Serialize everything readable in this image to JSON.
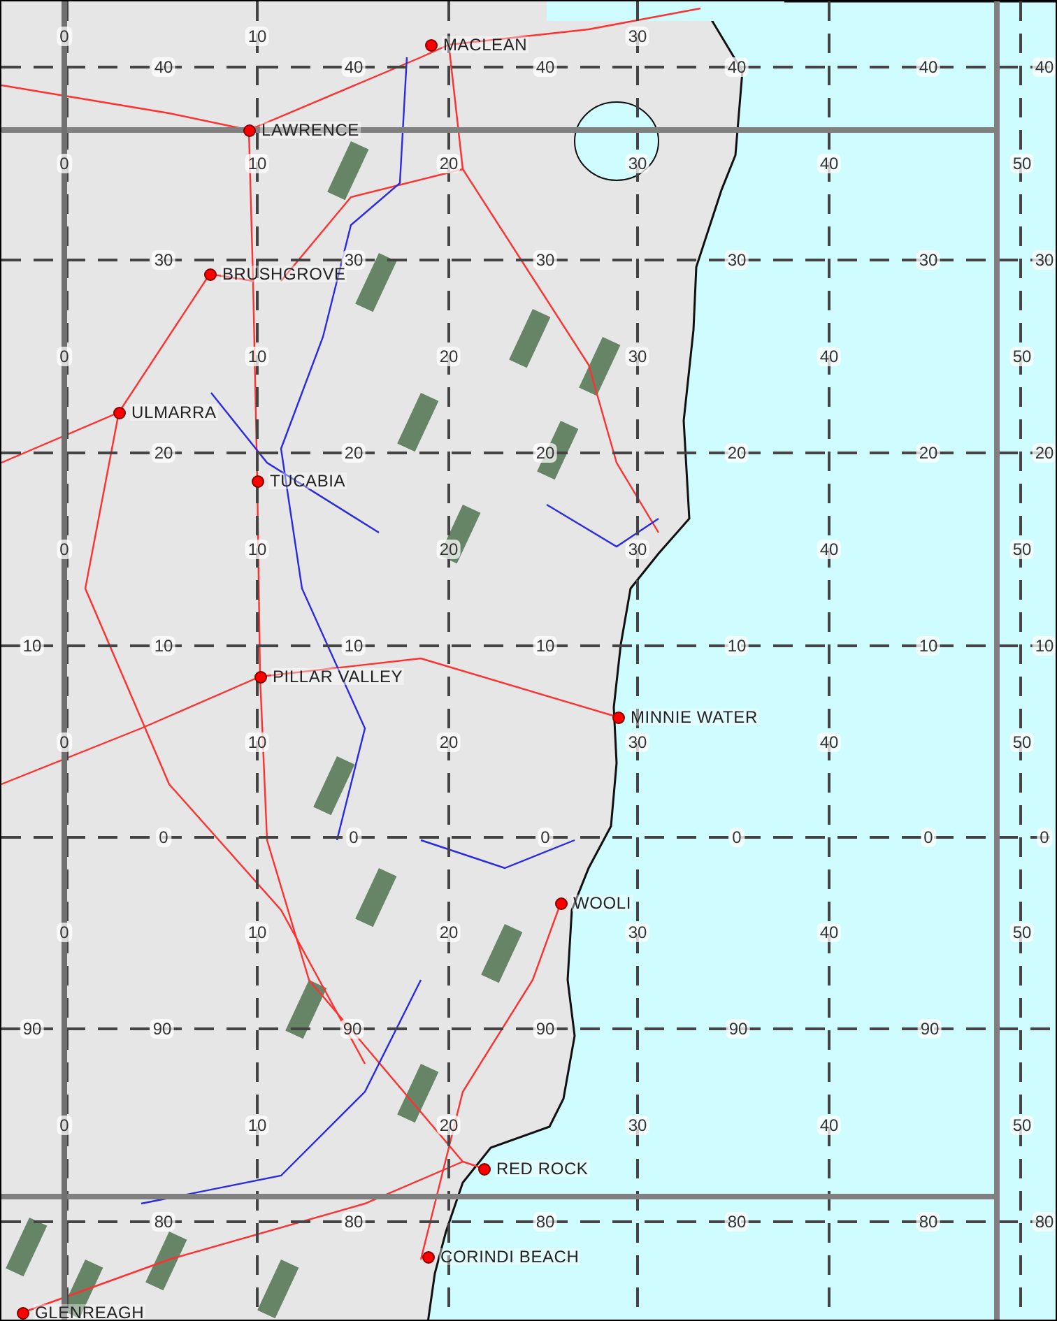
{
  "map": {
    "towns": [
      {
        "name": "MACLEAN"
      },
      {
        "name": "LAWRENCE"
      },
      {
        "name": "BRUSHGROVE"
      },
      {
        "name": "ULMARRA"
      },
      {
        "name": "TUCABIA"
      },
      {
        "name": "PILLAR VALLEY"
      },
      {
        "name": "MINNIE WATER"
      },
      {
        "name": "WOOLI"
      },
      {
        "name": "RED ROCK"
      },
      {
        "name": "CORINDI BEACH"
      },
      {
        "name": "GLENREAGH"
      }
    ],
    "grid_labels": [
      [
        "0",
        "10",
        "30"
      ],
      [
        "40",
        "40",
        "40",
        "40",
        "40",
        "40"
      ],
      [
        "0",
        "10",
        "20",
        "30",
        "40",
        "50"
      ],
      [
        "30",
        "30",
        "30",
        "30",
        "30",
        "30"
      ],
      [
        "0",
        "10",
        "20",
        "30",
        "40",
        "50"
      ],
      [
        "20",
        "20",
        "20",
        "20",
        "20",
        "20"
      ],
      [
        "0",
        "10",
        "20",
        "30",
        "40",
        "50"
      ],
      [
        "10",
        "10",
        "10",
        "10",
        "10",
        "10",
        "10"
      ],
      [
        "0",
        "10",
        "20",
        "30",
        "40",
        "50"
      ],
      [
        "0",
        "0",
        "0",
        "0",
        "0",
        "0"
      ],
      [
        "0",
        "10",
        "20",
        "30",
        "40",
        "50"
      ],
      [
        "90",
        "90",
        "90",
        "90",
        "90",
        "90"
      ],
      [
        "0",
        "10",
        "20",
        "30",
        "40",
        "50"
      ],
      [
        "80",
        "80",
        "80",
        "80",
        "80",
        "80"
      ]
    ]
  }
}
